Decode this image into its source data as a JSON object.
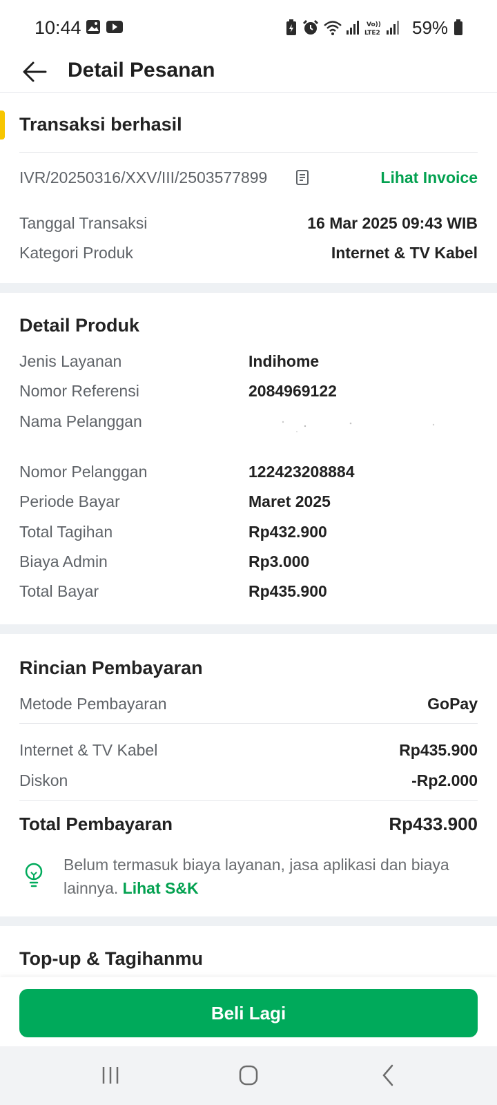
{
  "status_bar": {
    "time": "10:44",
    "battery_percent": "59%"
  },
  "app_bar": {
    "title": "Detail Pesanan"
  },
  "transaction": {
    "status_title": "Transaksi berhasil",
    "invoice_number": "IVR/20250316/XXV/III/2503577899",
    "invoice_link": "Lihat Invoice",
    "rows": [
      {
        "label": "Tanggal Transaksi",
        "value": "16 Mar 2025 09:43  WIB"
      },
      {
        "label": "Kategori Produk",
        "value": "Internet & TV Kabel"
      }
    ]
  },
  "product": {
    "title": "Detail Produk",
    "rows": [
      {
        "label": "Jenis Layanan",
        "value": "Indihome"
      },
      {
        "label": "Nomor Referensi",
        "value": "2084969122"
      },
      {
        "label": "Nama Pelanggan",
        "value": ""
      },
      {
        "label": "Nomor Pelanggan",
        "value": "122423208884"
      },
      {
        "label": "Periode Bayar",
        "value": "Maret 2025"
      },
      {
        "label": "Total Tagihan",
        "value": "Rp432.900"
      },
      {
        "label": "Biaya Admin",
        "value": "Rp3.000"
      },
      {
        "label": "Total Bayar",
        "value": "Rp435.900"
      }
    ]
  },
  "payment": {
    "title": "Rincian Pembayaran",
    "method_label": "Metode Pembayaran",
    "method_value": "GoPay",
    "rows": [
      {
        "label": "Internet & TV Kabel",
        "value": "Rp435.900"
      },
      {
        "label": "Diskon",
        "value": "-Rp2.000"
      }
    ],
    "total_label": "Total Pembayaran",
    "total_value": "Rp433.900",
    "note_text": "Belum termasuk biaya layanan, jasa aplikasi dan biaya lainnya.",
    "note_link": "Lihat S&K"
  },
  "topup": {
    "title": "Top-up & Tagihanmu"
  },
  "action": {
    "buy_again": "Beli Lagi"
  },
  "colors": {
    "accent_green": "#00aa5b",
    "link_green": "#03a150",
    "status_yellow": "#f7c600"
  }
}
